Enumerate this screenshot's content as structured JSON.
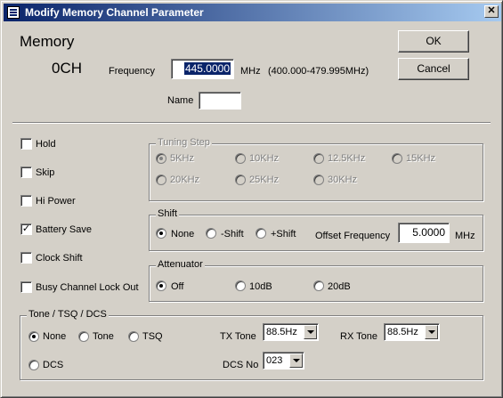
{
  "window": {
    "title": "Modify Memory Channel Parameter",
    "close_glyph": "✕"
  },
  "header": {
    "memory_heading": "Memory",
    "channel": "0CH"
  },
  "frequency": {
    "label": "Frequency",
    "value": "445.0000",
    "unit": "MHz",
    "range": "(400.000-479.995MHz)"
  },
  "name": {
    "label": "Name",
    "value": ""
  },
  "buttons": {
    "ok": "OK",
    "cancel": "Cancel"
  },
  "options": [
    {
      "label": "Hold",
      "checked": false
    },
    {
      "label": "Skip",
      "checked": false
    },
    {
      "label": "Hi Power",
      "checked": false
    },
    {
      "label": "Battery Save",
      "checked": true
    },
    {
      "label": "Clock Shift",
      "checked": false
    },
    {
      "label": "Busy Channel Lock Out",
      "checked": false
    }
  ],
  "tuning_step": {
    "title": "Tuning Step",
    "options": [
      "5KHz",
      "10KHz",
      "12.5KHz",
      "15KHz",
      "20KHz",
      "25KHz",
      "30KHz"
    ],
    "selected": "5KHz"
  },
  "shift": {
    "title": "Shift",
    "options": [
      "None",
      "-Shift",
      "+Shift"
    ],
    "selected": "None",
    "offset_label": "Offset Frequency",
    "offset_value": "5.0000",
    "offset_unit": "MHz"
  },
  "attenuator": {
    "title": "Attenuator",
    "options": [
      "Off",
      "10dB",
      "20dB"
    ],
    "selected": "Off"
  },
  "tone": {
    "title": "Tone / TSQ / DCS",
    "options": [
      "None",
      "Tone",
      "TSQ",
      "DCS"
    ],
    "selected": "None",
    "tx_label": "TX Tone",
    "tx_value": "88.5Hz",
    "rx_label": "RX Tone",
    "rx_value": "88.5Hz",
    "dcs_label": "DCS No",
    "dcs_value": "023"
  }
}
